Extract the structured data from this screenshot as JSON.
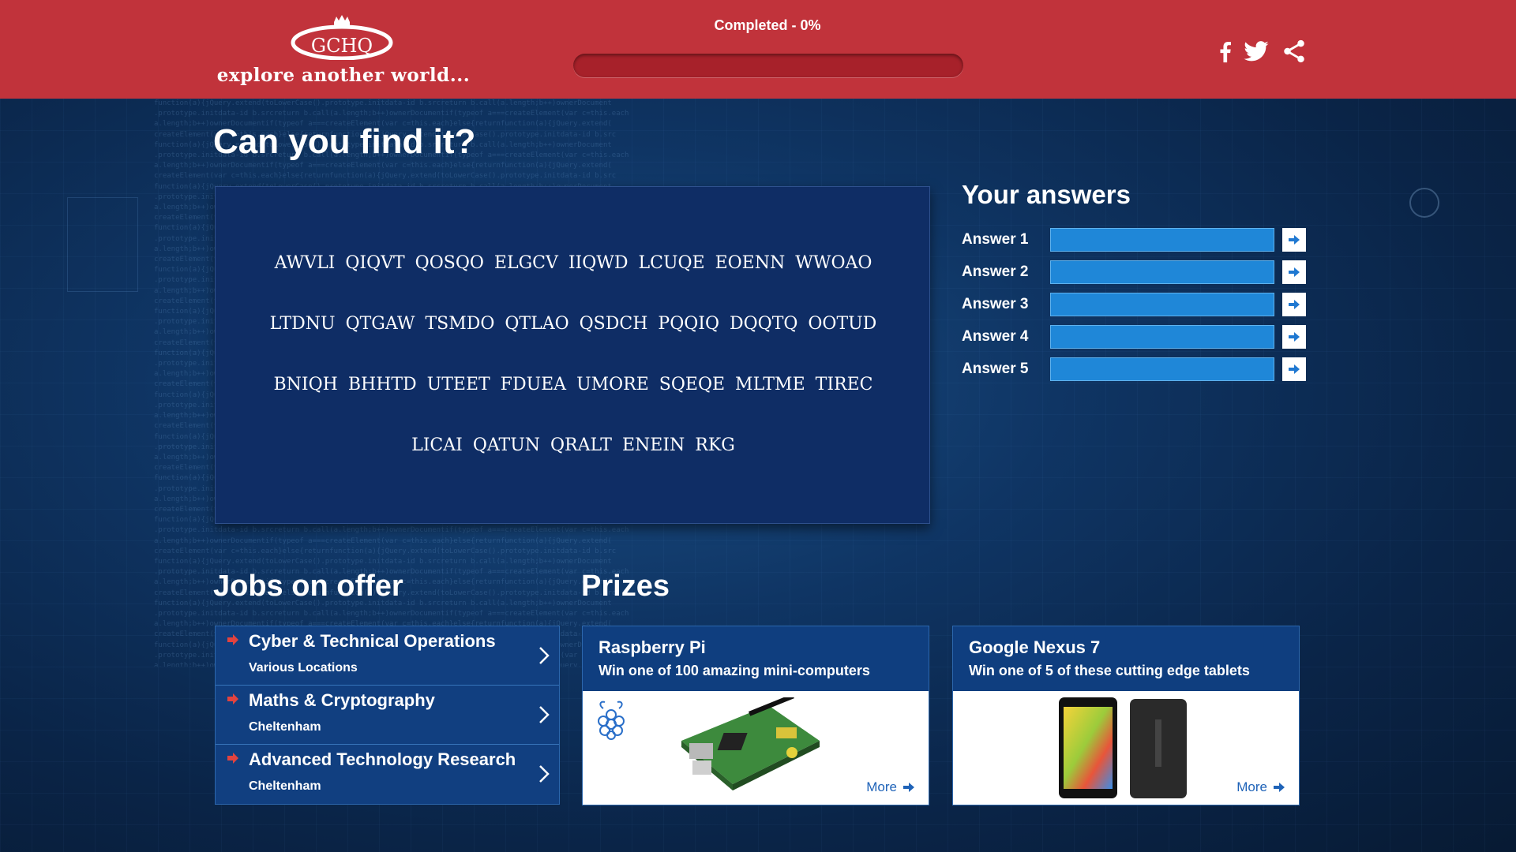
{
  "header": {
    "logo_text": "GCHQ",
    "tagline": "explore another world...",
    "progress_label": "Completed - 0%",
    "progress_fraction": 0.0,
    "social_icons": [
      "facebook-icon",
      "twitter-icon",
      "share-icon"
    ]
  },
  "puzzle": {
    "title": "Can you find it?",
    "lines": [
      "AWVLI QIQVT QOSQO ELGCV IIQWD LCUQE EOENN WWOAO",
      "LTDNU QTGAW TSMDO QTLAO QSDCH PQQIQ DQQTQ OOTUD",
      "BNIQH BHHTD UTEET FDUEA UMORE SQEQE MLTME TIREC",
      "LICAI QATUN QRALT ENEIN RKG"
    ]
  },
  "answers": {
    "title": "Your answers",
    "items": [
      {
        "label": "Answer 1",
        "value": ""
      },
      {
        "label": "Answer 2",
        "value": ""
      },
      {
        "label": "Answer 3",
        "value": ""
      },
      {
        "label": "Answer 4",
        "value": ""
      },
      {
        "label": "Answer 5",
        "value": ""
      }
    ]
  },
  "jobs": {
    "title": "Jobs on offer",
    "items": [
      {
        "title": "Cyber & Technical Operations",
        "location": "Various Locations"
      },
      {
        "title": "Maths & Cryptography",
        "location": "Cheltenham"
      },
      {
        "title": "Advanced Technology Research",
        "location": "Cheltenham"
      }
    ]
  },
  "prizes": {
    "title": "Prizes",
    "items": [
      {
        "name": "Raspberry Pi",
        "description": "Win one of 100 amazing mini-computers",
        "more_label": "More"
      },
      {
        "name": "Google Nexus 7",
        "description": "Win one of 5 of these cutting edge tablets",
        "more_label": "More"
      }
    ]
  },
  "colors": {
    "header_red": "#c1333b",
    "panel_blue": "#0f3e7f",
    "input_blue": "#1f87d8",
    "accent_red": "#e2433f"
  }
}
